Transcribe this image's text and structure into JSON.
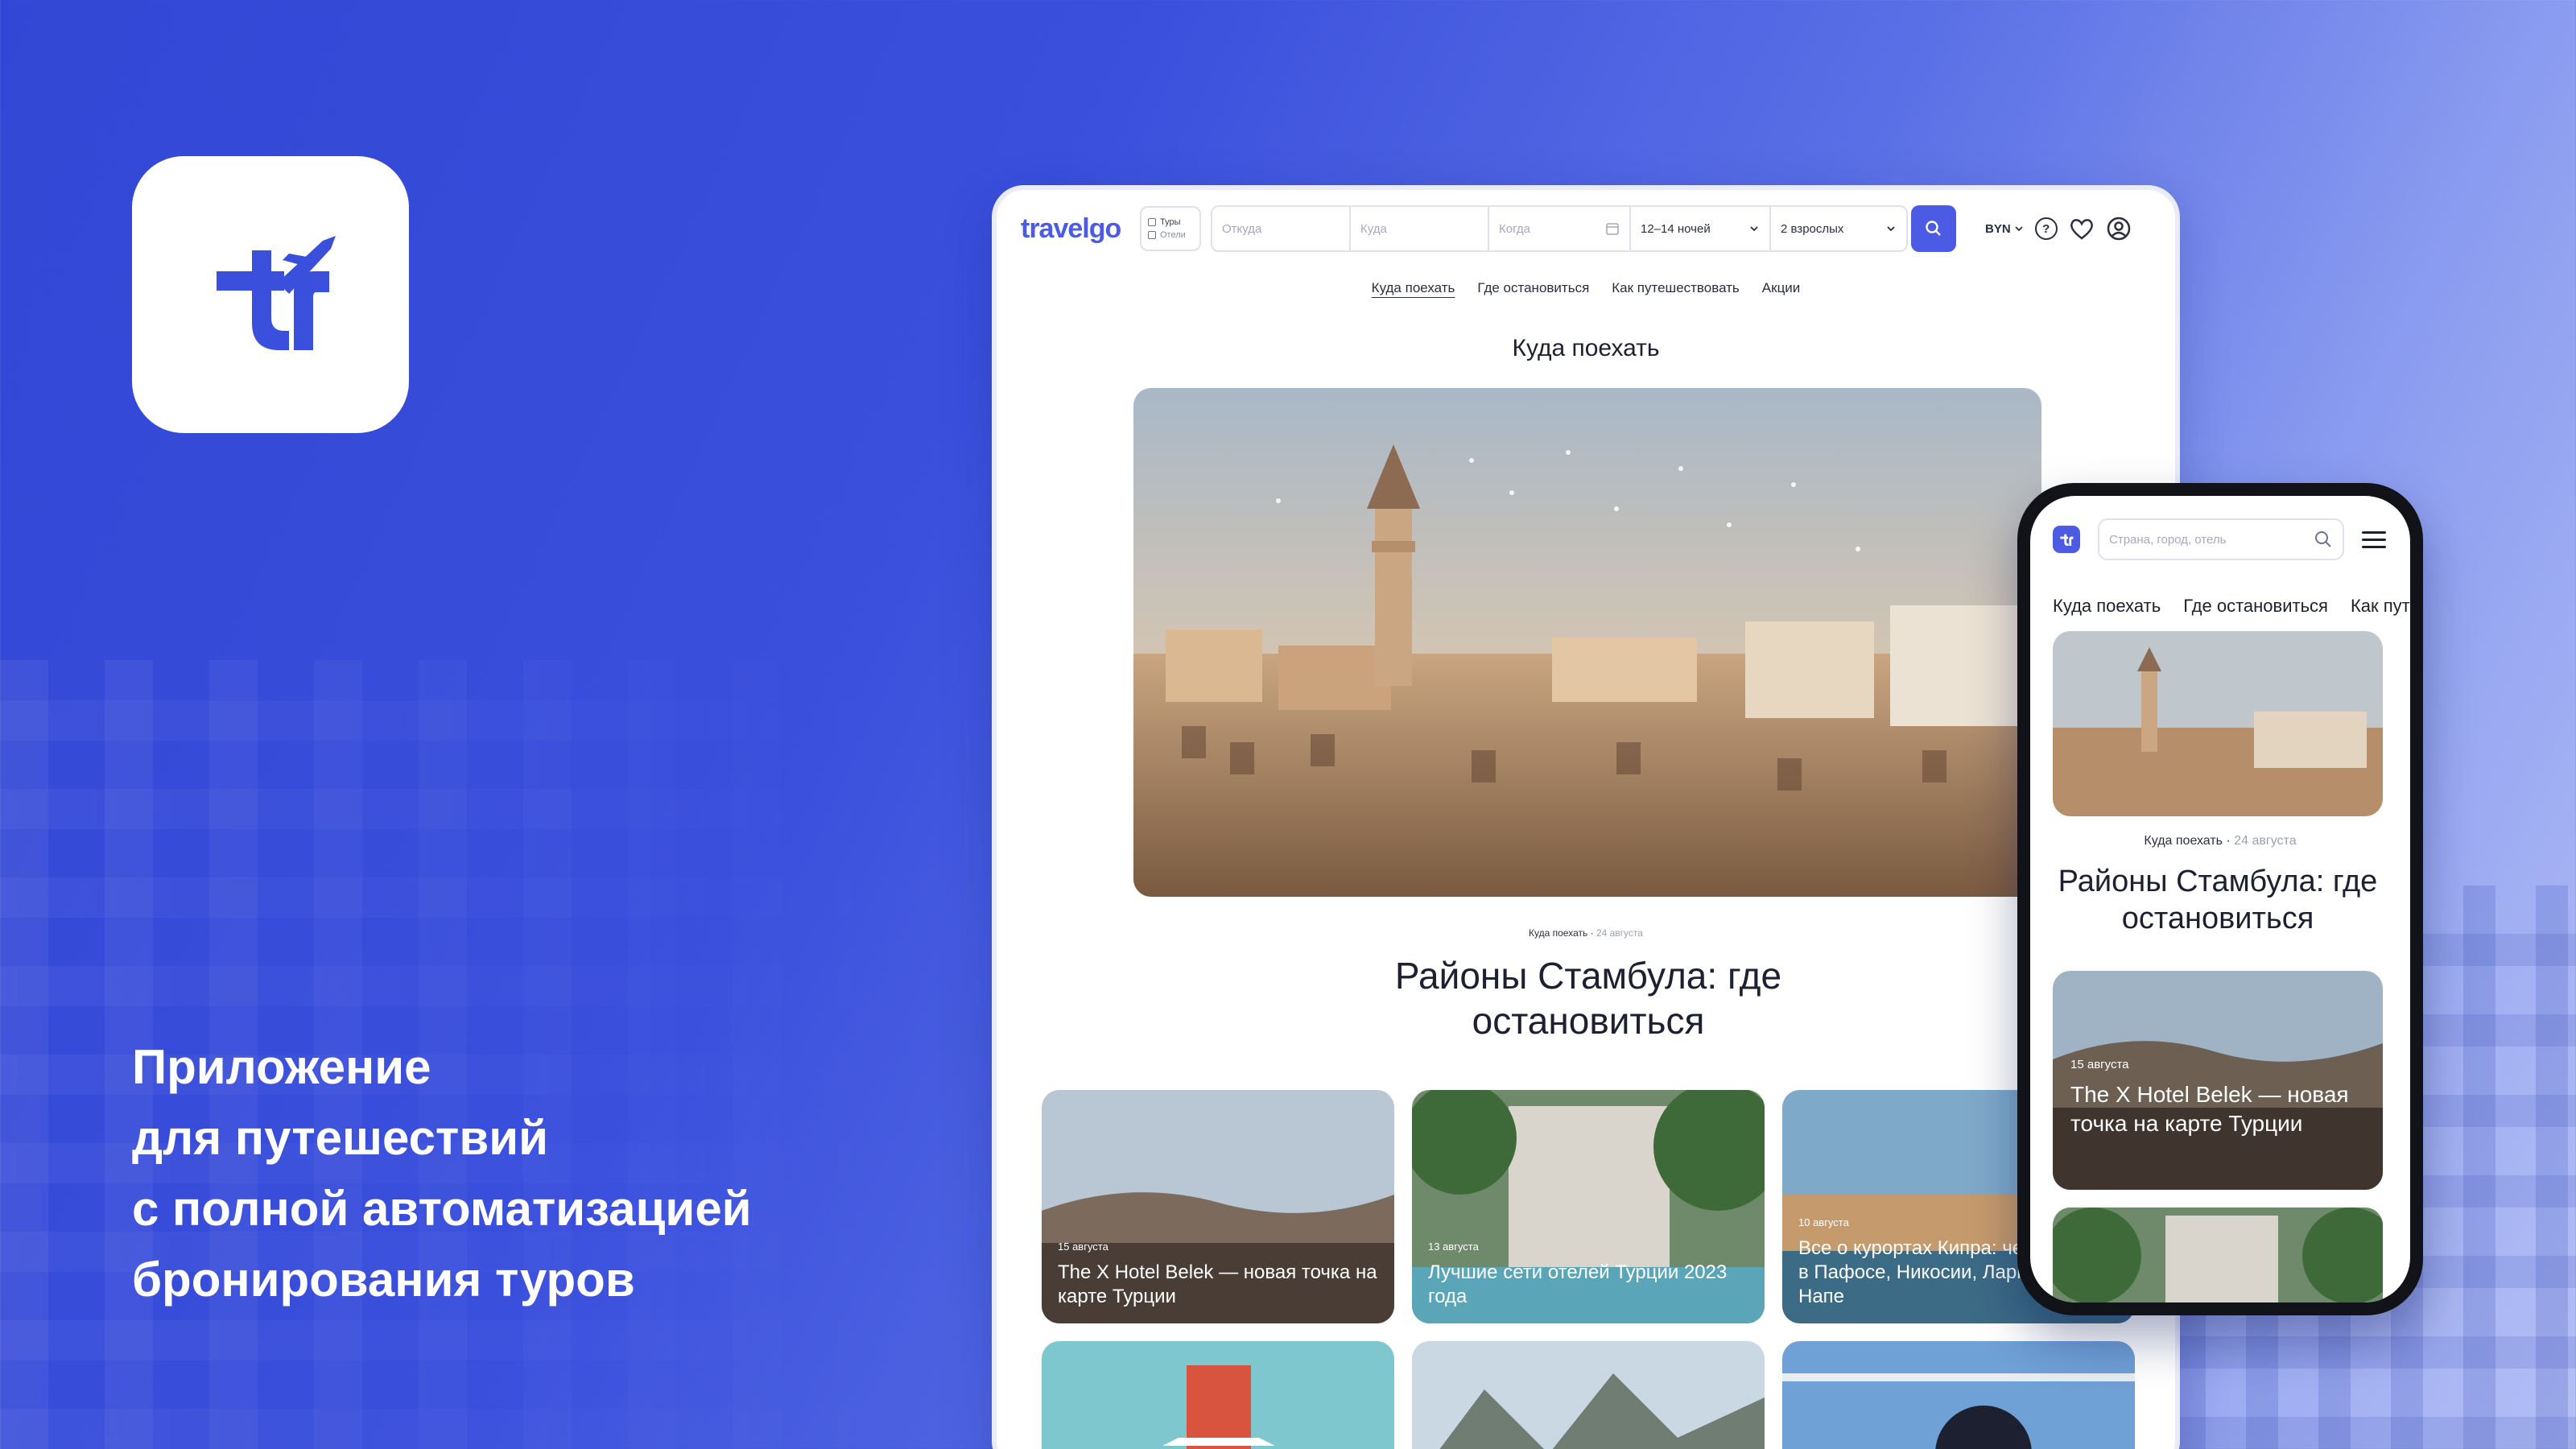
{
  "headline": {
    "line1": "Приложение",
    "line2": "для путешествий",
    "line3": "с полной автоматизацией",
    "line4": "бронирования туров"
  },
  "desktop": {
    "logo": "travelgo",
    "mode": {
      "tours": "Туры",
      "hotels": "Отели"
    },
    "search": {
      "from_placeholder": "Откуда",
      "to_placeholder": "Куда",
      "when_placeholder": "Когда",
      "nights": "12–14 ночей",
      "guests": "2 взрослых"
    },
    "currency": "BYN",
    "nav": [
      "Куда поехать",
      "Где остановиться",
      "Как путешествовать",
      "Акции"
    ],
    "section_title": "Куда поехать",
    "article": {
      "category": "Куда поехать",
      "date": "24 августа",
      "title": "Районы Стамбула: где остановиться"
    },
    "cards": [
      {
        "date": "15 августа",
        "title": "The X Hotel Belek — новая точка на карте Турции"
      },
      {
        "date": "13 августа",
        "title": "Лучшие сети отелей Турции 2023 года"
      },
      {
        "date": "10 августа",
        "title": "Все о курортах Кипра: чем заняться в Пафосе, Никосии, Ларнаке и Айя Напе"
      }
    ]
  },
  "phone": {
    "search_placeholder": "Страна, город, отель",
    "nav": [
      "Куда поехать",
      "Где остановиться",
      "Как путешествовать"
    ],
    "article": {
      "category": "Куда поехать",
      "date": "24 августа",
      "title": "Районы Стамбула: где остановиться"
    },
    "card": {
      "date": "15 августа",
      "title": "The X Hotel Belek — новая точка на карте Турции"
    }
  },
  "colors": {
    "brand": "#4b5be3",
    "background": "#3a4fdc"
  }
}
